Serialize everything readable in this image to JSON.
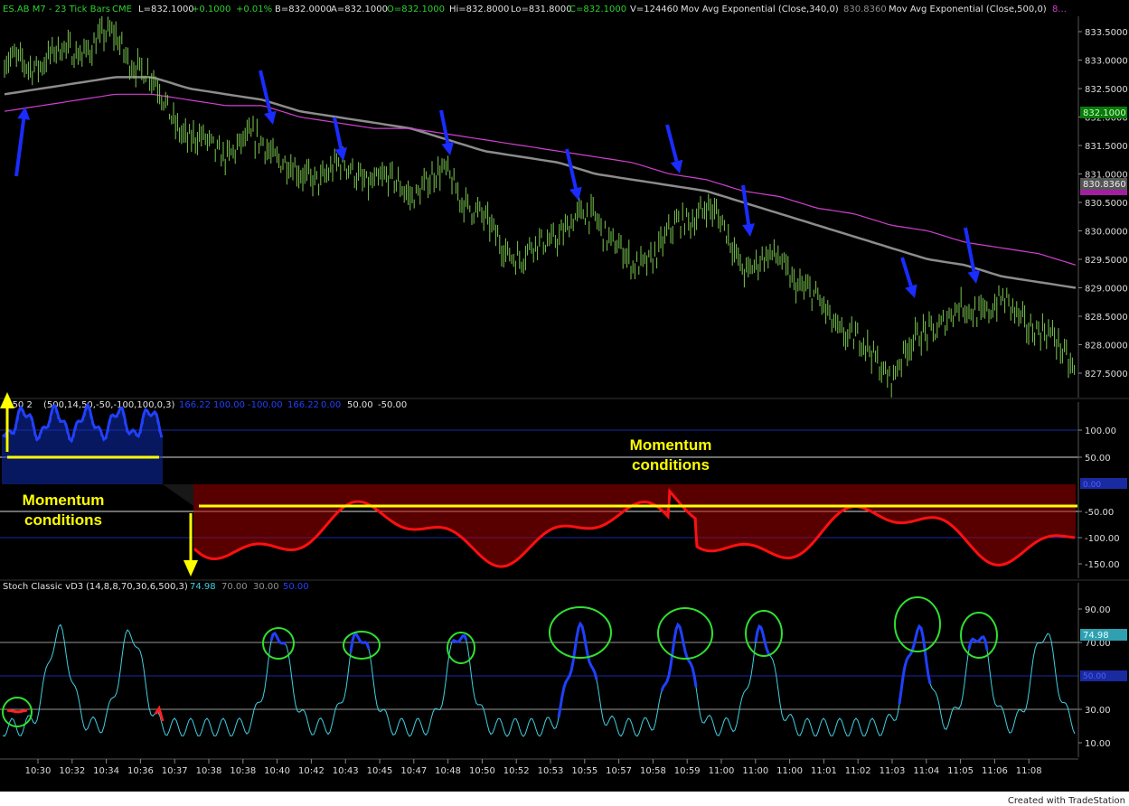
{
  "header": {
    "symbol": "ES.AB M7 - 23 Tick Bars",
    "exchange": "CME",
    "last": "L=832.1000",
    "change": "+0.1000",
    "change_pct": "+0.01%",
    "bid": "B=832.0000",
    "ask": "A=832.1000",
    "open": "O=832.1000",
    "high": "Hi=832.8000",
    "low": "Lo=831.8000",
    "close": "C=832.1000",
    "volume": "V=124460",
    "ma1_label": "Mov Avg Exponential (Close,340,0)",
    "ma1_value": "830.8360",
    "ma2_label": "Mov Avg Exponential (Close,500,0)",
    "ma2_value": "8..."
  },
  "price_axis": {
    "ticks": [
      "833.5000",
      "833.0000",
      "832.5000",
      "832.0000",
      "831.5000",
      "831.0000",
      "830.5000",
      "830.0000",
      "829.5000",
      "829.0000",
      "828.5000",
      "828.0000",
      "827.5000"
    ],
    "last_badge": "832.1000",
    "ma_badge": "830.8360"
  },
  "indicator1": {
    "title": "L50 2",
    "params": "(500,14,50,-50,-100,100,0,3)",
    "v1": "166.22",
    "v2": "100.00",
    "v3": "-100.00",
    "v4": "166.22",
    "v5": "0.00",
    "v6": "50.00",
    "v7": "-50.00",
    "ticks": [
      "100.00",
      "50.00",
      "-50.00",
      "-100.00",
      "-150.00"
    ],
    "badge": "0.00"
  },
  "annotations": {
    "momentum_top_line1": "Momentum",
    "momentum_top_line2": "conditions",
    "momentum_left_line1": "Momentum",
    "momentum_left_line2": "conditions"
  },
  "indicator2": {
    "title": "Stoch Classic vD3",
    "params": "(14,8,8,70,30,6,500,3)",
    "v1": "74.98",
    "v2": "70.00",
    "v3": "30.00",
    "v4": "50.00",
    "ticks": [
      "90.00",
      "70.00",
      "30.00",
      "10.00"
    ],
    "badge": "74.98",
    "badge2": "50.00"
  },
  "time_axis": [
    "10:30",
    "10:32",
    "10:34",
    "10:36",
    "10:37",
    "10:38",
    "10:38",
    "10:40",
    "10:42",
    "10:43",
    "10:45",
    "10:47",
    "10:48",
    "10:50",
    "10:52",
    "10:53",
    "10:55",
    "10:57",
    "10:58",
    "10:59",
    "11:00",
    "11:00",
    "11:00",
    "11:01",
    "11:02",
    "11:03",
    "11:04",
    "11:05",
    "11:06",
    "11:08"
  ],
  "footer": "Created with TradeStation",
  "colors": {
    "bars": "#7ac74f",
    "ma_gray": "#8c8c8c",
    "ma_magenta": "#d040d0",
    "arrow_blue": "#1a2cff",
    "arrow_yellow": "#ffff00",
    "hist_blue": "#1030c0",
    "hist_red": "#b00000",
    "stoch_cyan": "#40d0e0",
    "circle_green": "#30e030"
  },
  "chart_data": {
    "type": "line",
    "title": "ES.AB M7 - 23 Tick Bars",
    "x": [
      "10:30",
      "10:32",
      "10:34",
      "10:36",
      "10:37",
      "10:38",
      "10:38",
      "10:40",
      "10:42",
      "10:43",
      "10:45",
      "10:47",
      "10:48",
      "10:50",
      "10:52",
      "10:53",
      "10:55",
      "10:57",
      "10:58",
      "10:59",
      "11:00",
      "11:00",
      "11:00",
      "11:01",
      "11:02",
      "11:03",
      "11:04",
      "11:05",
      "11:06",
      "11:08"
    ],
    "series": [
      {
        "name": "Close",
        "values": [
          832.9,
          833.0,
          833.2,
          833.4,
          832.6,
          831.6,
          831.4,
          831.6,
          830.9,
          831.1,
          830.9,
          830.7,
          831.0,
          830.1,
          829.5,
          830.0,
          830.3,
          829.3,
          829.9,
          830.5,
          829.4,
          829.5,
          828.7,
          828.1,
          827.5,
          828.3,
          828.6,
          828.7,
          828.3,
          827.6
        ]
      },
      {
        "name": "Mov Avg Exponential (Close,340,0)",
        "values": [
          832.4,
          832.5,
          832.6,
          832.7,
          832.7,
          832.5,
          832.4,
          832.3,
          832.1,
          832.0,
          831.9,
          831.8,
          831.6,
          831.4,
          831.3,
          831.2,
          831.0,
          830.9,
          830.8,
          830.7,
          830.5,
          830.3,
          830.1,
          829.9,
          829.7,
          829.5,
          829.4,
          829.2,
          829.1,
          829.0
        ]
      },
      {
        "name": "Mov Avg Exponential (Close,500,0)",
        "values": [
          832.1,
          832.2,
          832.3,
          832.4,
          832.4,
          832.3,
          832.2,
          832.2,
          832.0,
          831.9,
          831.8,
          831.8,
          831.7,
          831.6,
          831.5,
          831.4,
          831.3,
          831.2,
          831.0,
          830.9,
          830.7,
          830.6,
          830.4,
          830.3,
          830.1,
          830.0,
          829.8,
          829.7,
          829.6,
          829.4
        ]
      }
    ],
    "ylim": [
      827.3,
      833.8
    ]
  }
}
